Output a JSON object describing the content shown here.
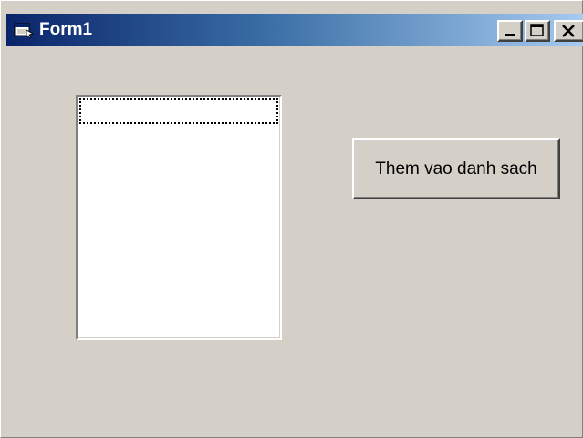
{
  "window": {
    "title": "Form1",
    "colors": {
      "face": "#d4d0c8",
      "title_start": "#0a246a",
      "title_end": "#a6caf0"
    }
  },
  "titlebar": {
    "icon": "form-window-icon",
    "buttons": [
      "minimize-icon",
      "maximize-icon",
      "close-icon"
    ]
  },
  "listbox": {
    "items": [],
    "selected_index": 0
  },
  "button": {
    "label": "Them vao danh sach"
  }
}
